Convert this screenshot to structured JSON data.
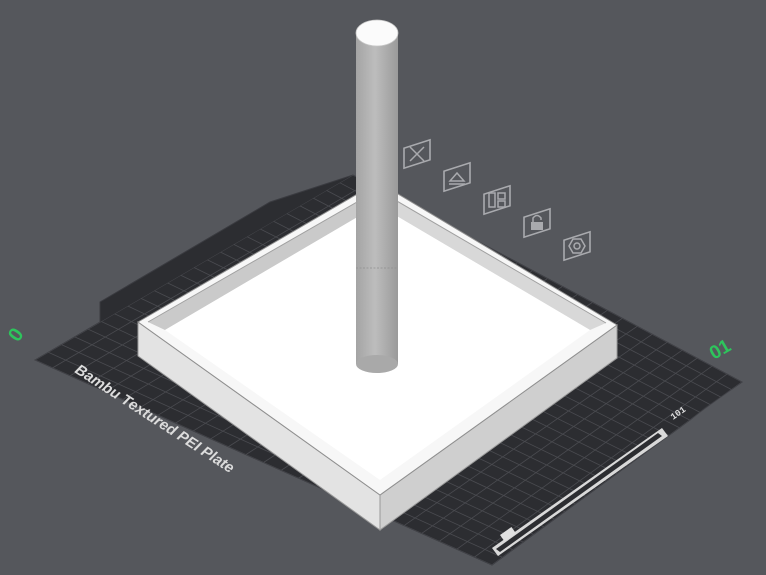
{
  "viewport": {
    "background": "#55575c"
  },
  "build_plate": {
    "label": "Bambu Textured PEI Plate",
    "plate_number": "01",
    "axis_marker": "0",
    "plate_color": "#2c2d31",
    "grid_color": "#4a4b50"
  },
  "plate_toolbar": {
    "icons": [
      "close-icon",
      "auto-orient-icon",
      "arrange-icon",
      "lock-icon",
      "settings-icon"
    ]
  },
  "model": {
    "box_color": "#f2f2f2",
    "cylinder_color": "#b5b5b5"
  },
  "accent_color": "#2ec45c"
}
